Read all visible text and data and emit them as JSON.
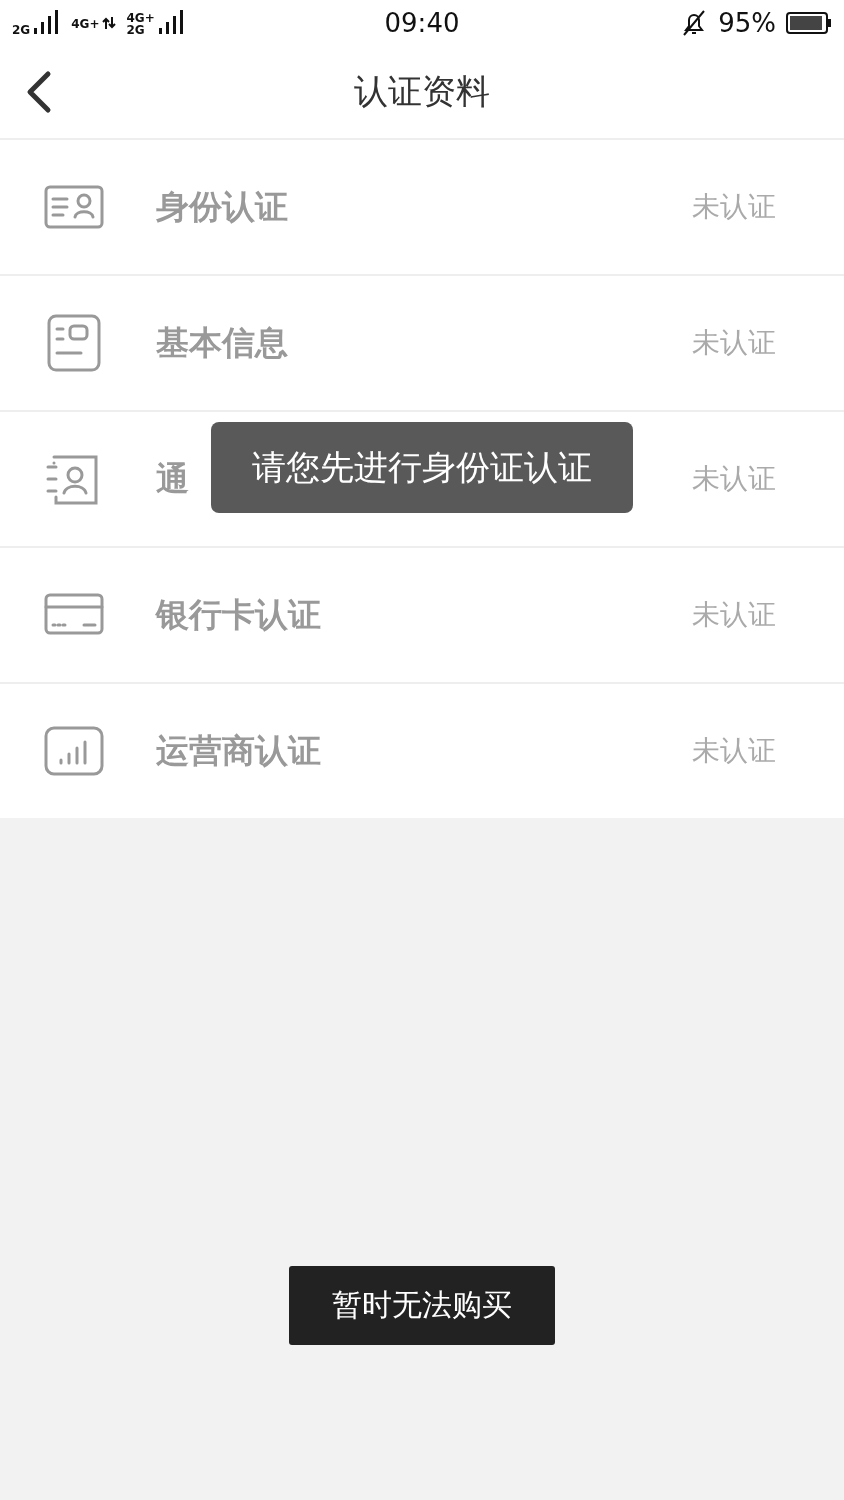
{
  "status_bar": {
    "signals": [
      {
        "label": "2G"
      },
      {
        "label": "4G+"
      },
      {
        "label": "4G+",
        "sub": "2G"
      }
    ],
    "time": "09:40",
    "battery_text": "95%"
  },
  "nav": {
    "title": "认证资料"
  },
  "items": [
    {
      "kind": "id-card",
      "title": "身份认证",
      "status": "未认证"
    },
    {
      "kind": "profile",
      "title": "基本信息",
      "status": "未认证"
    },
    {
      "kind": "contacts",
      "title": "通",
      "status": "未认证"
    },
    {
      "kind": "bank-card",
      "title": "银行卡认证",
      "status": "未认证"
    },
    {
      "kind": "signal",
      "title": "运营商认证",
      "status": "未认证"
    }
  ],
  "toast": {
    "text": "请您先进行身份证认证"
  },
  "bottom_button": {
    "label": "暂时无法购买"
  }
}
